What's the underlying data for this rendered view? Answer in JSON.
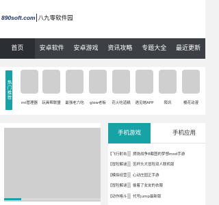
{
  "header": {
    "logo_domain": "890soft.com",
    "logo_name": "八九零软件园"
  },
  "nav": {
    "items": [
      {
        "label": "首页"
      },
      {
        "label": "安卓软件"
      },
      {
        "label": "安卓游戏"
      },
      {
        "label": "资讯攻略"
      },
      {
        "label": "专题大全"
      },
      {
        "label": "最近更新"
      }
    ]
  },
  "hot": {
    "badge": "热门推荐",
    "apps": [
      {
        "name": "mt管理器"
      },
      {
        "name": "玩具帮联盟"
      },
      {
        "name": "最强老六吃"
      },
      {
        "name": "glow老板"
      },
      {
        "name": "花火吃道糕"
      },
      {
        "name": "遇见她APP"
      },
      {
        "name": "陌讯"
      },
      {
        "name": "樱花动漫"
      }
    ]
  },
  "banner": {
    "progress": 0.18,
    "colors": {
      "accent": "#17a2a5",
      "track": "#dadada"
    }
  },
  "panel": {
    "tabs": [
      {
        "label": "手机游戏",
        "active": true
      },
      {
        "label": "手机应用",
        "active": false
      }
    ],
    "news": [
      {
        "category": "【飞行射击】",
        "title": "燃烧战争8截图的梦想mod手游"
      },
      {
        "category": "【冒险解谜】",
        "title": "苦杯头大冒险双人联机版"
      },
      {
        "category": "【模拟经营】",
        "title": "心动庄园正手游"
      },
      {
        "category": "【冒险解谜】",
        "title": "偷着了女友的衣服"
      },
      {
        "category": "【动作格斗】",
        "title": "代号jump最新版"
      }
    ]
  },
  "colors": {
    "nav_bg": "#3c4045",
    "nav_active": "#2b2e32",
    "accent": "#17a2a5"
  }
}
